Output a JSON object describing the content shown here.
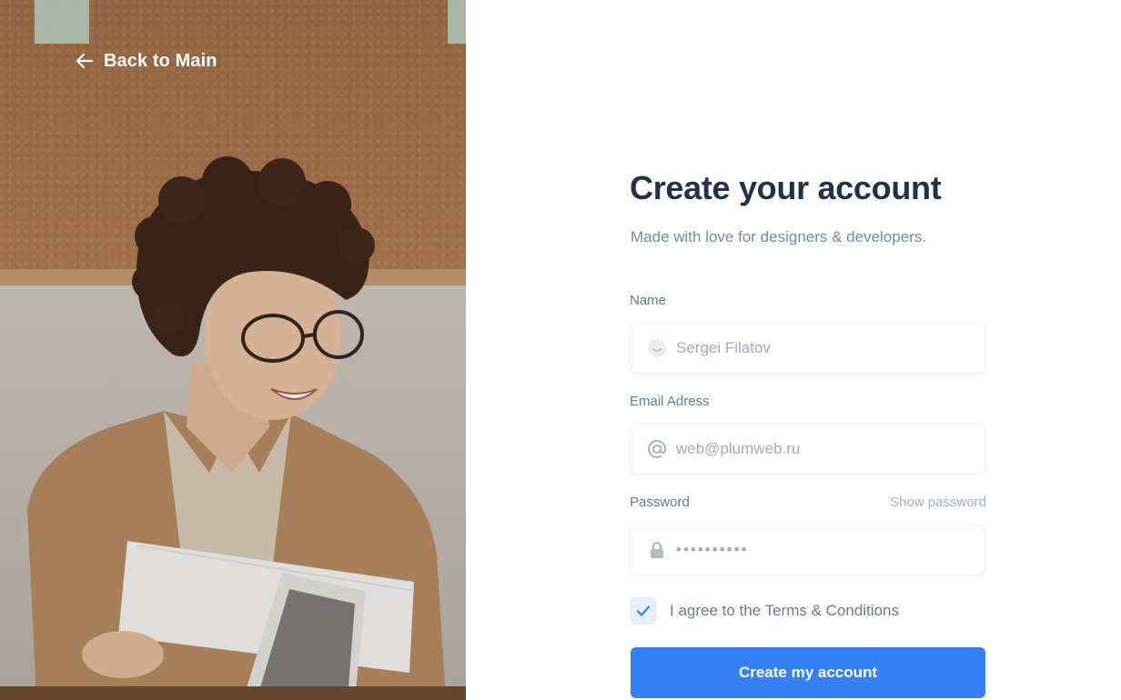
{
  "back_link": {
    "label": "Back to Main",
    "icon": "arrow-left-icon"
  },
  "hero": {
    "icon": "woman-reading-papers-photo"
  },
  "form": {
    "title": "Create your account",
    "subtitle": "Made with love for designers & developers.",
    "name": {
      "label": "Name",
      "placeholder": "Sergei Filatov",
      "icon": "smile-icon"
    },
    "email": {
      "label": "Email Adress",
      "placeholder": "web@plumweb.ru",
      "icon": "at-icon"
    },
    "password": {
      "label": "Password",
      "show_label": "Show password",
      "value": "••••••••••",
      "icon": "lock-icon"
    },
    "terms": {
      "label": "I agree to the Terms & Conditions",
      "checked": true
    },
    "submit_label": "Create my account"
  },
  "colors": {
    "accent": "#3580f5",
    "title": "#253246",
    "muted": "#7d889a",
    "checkbox_bg": "#e7effb"
  }
}
